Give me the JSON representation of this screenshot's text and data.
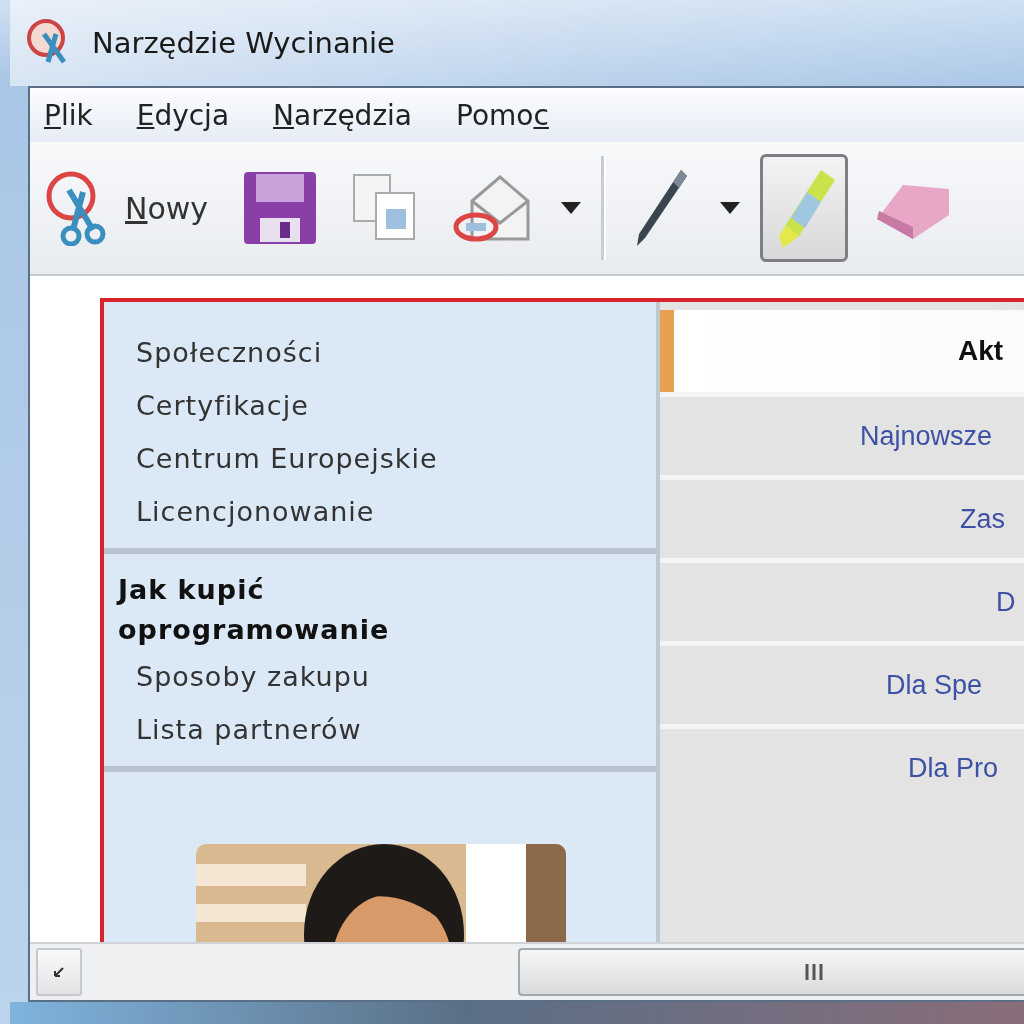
{
  "window": {
    "title": "Narzędzie Wycinanie"
  },
  "menu": [
    {
      "key": "P",
      "after": "lik"
    },
    {
      "key": "E",
      "after": "dycja"
    },
    {
      "key": "N",
      "after": "arzędzia"
    },
    {
      "before": "Pomo",
      "key": "c"
    }
  ],
  "toolbar": [
    {
      "kind": "new",
      "key": "N",
      "rest": "owy",
      "selected": false
    },
    {
      "kind": "save",
      "selected": false
    },
    {
      "kind": "copy",
      "selected": false
    },
    {
      "kind": "send",
      "selected": false
    },
    {
      "kind": "dropdown"
    },
    {
      "kind": "separator"
    },
    {
      "kind": "pen",
      "selected": false
    },
    {
      "kind": "dropdown"
    },
    {
      "kind": "highlighter",
      "selected": true
    },
    {
      "kind": "eraser",
      "selected": false
    }
  ],
  "capture": {
    "sidebar": {
      "items": [
        "Społeczności",
        "Certyfikacje",
        "Centrum Europejskie",
        "Licencjonowanie"
      ],
      "heading": "Jak kupić oprogramowanie",
      "links": [
        "Sposoby zakupu",
        "Lista partnerów"
      ],
      "photo": {
        "kind": "picture"
      }
    },
    "panel": {
      "header": "Akt",
      "rows": [
        "Najnowsze",
        "Zas",
        "D",
        "Dla Spe",
        "Dla Pro"
      ]
    }
  }
}
